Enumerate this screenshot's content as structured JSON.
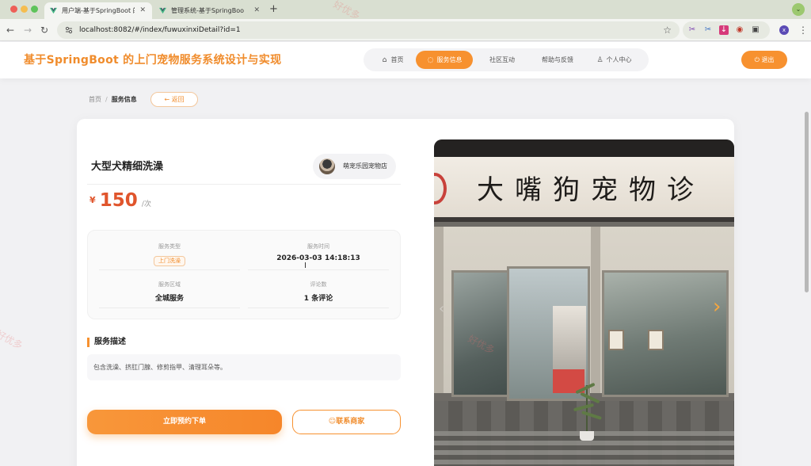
{
  "browser": {
    "tabs": [
      {
        "title": "用户端-基于SpringBoot 的上门宠",
        "active": true
      },
      {
        "title": "管理系统-基于SpringBoot 的上门宠",
        "active": false
      }
    ],
    "new_tab": "+",
    "url": "localhost:8082/#/index/fuwuxinxiDetail?id=1",
    "profile_initial": "x"
  },
  "header": {
    "title": "基于SpringBoot 的上门宠物服务系统设计与实现",
    "nav": [
      {
        "label": "首页",
        "icon": "home-icon",
        "active": false
      },
      {
        "label": "服务信息",
        "icon": "chat-bubble-icon",
        "active": true
      },
      {
        "label": "社区互动",
        "icon": "",
        "active": false
      },
      {
        "label": "帮助与反馈",
        "icon": "",
        "active": false
      },
      {
        "label": "个人中心",
        "icon": "user-icon",
        "active": false
      }
    ],
    "logout_label": "退出"
  },
  "breadcrumb": {
    "home": "首页",
    "separator": "/",
    "current": "服务信息"
  },
  "back_label": "← 返回",
  "service": {
    "title": "大型犬精细洗澡",
    "shop_name": "萌宠乐园宠物店",
    "currency": "¥",
    "price": "150",
    "unit": "/次",
    "info": {
      "type_label": "服务类型",
      "type_value": "上门洗澡",
      "time_label": "服务时间",
      "time_value": "2026-03-03 14:18:13",
      "area_label": "服务区域",
      "area_value": "全城服务",
      "comments_label": "评论数",
      "comments_value": "1 条评论"
    },
    "description_title": "服务描述",
    "description": "包含洗澡、挤肛门腺、修剪指甲、清理耳朵等。"
  },
  "actions": {
    "book_label": "立即预约下单",
    "contact_label": "联系商家"
  },
  "gallery": {
    "sign_text": "大嘴狗宠物诊"
  },
  "watermark": "好优多",
  "colors": {
    "accent": "#f7912f",
    "price": "#e0552c"
  }
}
